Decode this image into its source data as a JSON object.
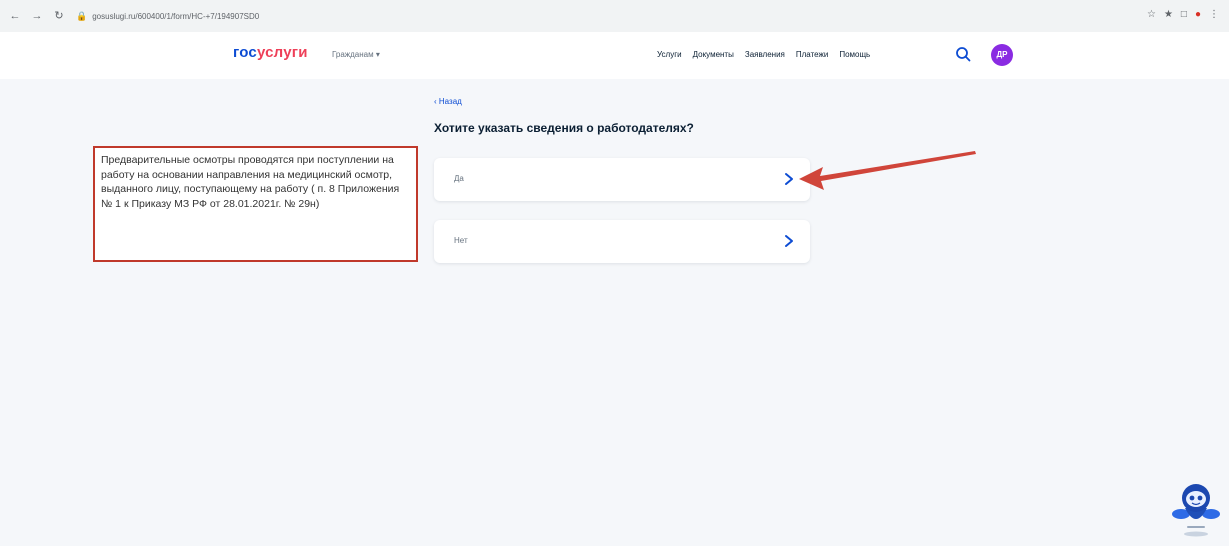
{
  "browser": {
    "url": "gosuslugi.ru/600400/1/form/HC-+7/194907SD0",
    "back_glyph": "←",
    "forward_glyph": "→",
    "reload_glyph": "↻",
    "actions": [
      "☆",
      "★",
      "□",
      "●",
      "⋮"
    ]
  },
  "header": {
    "logo_part_a": "гос",
    "logo_part_b": "услуги",
    "role_switch": "Гражданам ▾",
    "nav": [
      "Услуги",
      "Документы",
      "Заявления",
      "Платежи",
      "Помощь"
    ],
    "avatar_initials": "ДР"
  },
  "page": {
    "back_link": "‹ Назад",
    "question": "Хотите указать сведения о работодателях?",
    "options": [
      {
        "label": "Да"
      },
      {
        "label": "Нет"
      }
    ]
  },
  "annotation": {
    "note": "Предварительные осмотры проводятся при поступлении на работу на основании направления на медицинский осмотр, выданного лицу, поступающему на работу ( п. 8 Приложения № 1 к Приказу МЗ РФ от 28.01.2021г. № 29н)",
    "box_color": "#c0392b",
    "arrow_color": "#d0453a"
  },
  "colors": {
    "brand_blue": "#0d4cd3",
    "brand_red": "#ee3f58",
    "avatar": "#8a2be2",
    "background": "#f5f7fa"
  },
  "icons": {
    "search": "search-icon",
    "chevron": "chevron-right-icon",
    "assistant": "robot-assistant-icon"
  }
}
